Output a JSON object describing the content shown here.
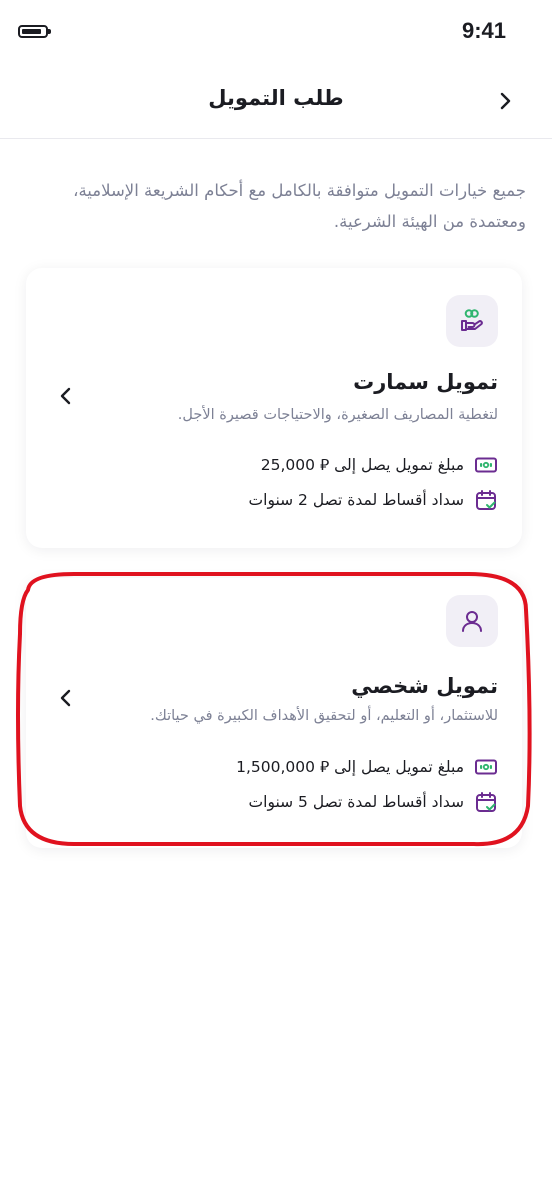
{
  "status_bar": {
    "time": "9:41"
  },
  "header": {
    "title": "طلب التمويل"
  },
  "intro": {
    "text": "جميع خيارات التمويل متوافقة بالكامل مع أحكام الشريعة الإسلامية، ومعتمدة من الهيئة الشرعية."
  },
  "options": [
    {
      "icon": "hand-coins-icon",
      "title": "تمويل سمارت",
      "description": "لتغطية المصاريف الصغيرة، والاحتياجات قصيرة الأجل.",
      "amount_text": "مبلغ تمويل يصل إلى ⃁ 25,000",
      "installments_text": "سداد أقساط لمدة تصل 2 سنوات"
    },
    {
      "icon": "user-icon",
      "title": "تمويل شخصي",
      "description": "للاستثمار، أو التعليم، أو لتحقيق الأهداف الكبيرة في حياتك.",
      "amount_text": "مبلغ تمويل يصل إلى ⃁ 1,500,000",
      "installments_text": "سداد أقساط لمدة تصل 5 سنوات"
    }
  ],
  "colors": {
    "accent": "#6b2c91",
    "muted_text": "#7d8195",
    "icon_bg": "#f1eff6",
    "check_green": "#2fb56e",
    "highlight_red": "#e0121f"
  }
}
